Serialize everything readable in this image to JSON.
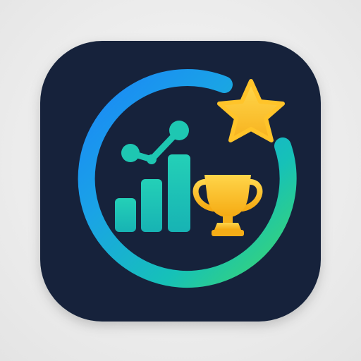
{
  "icon": {
    "name": "progress-achievement-app-icon",
    "shape": "rounded-square",
    "colors": {
      "page_background": "#ececec",
      "tile": "#13243b",
      "ring_start": "#1e8ff5",
      "ring_mid": "#16b9c9",
      "ring_end": "#41d86f",
      "bars": "#1ec8b4",
      "trophy": "#ffc21f",
      "star": "#ffc42a"
    },
    "elements": [
      "progress-ring",
      "bar-chart",
      "trend-line",
      "trophy",
      "star"
    ],
    "bars_relative_heights": [
      0.45,
      0.7,
      1.0
    ]
  }
}
